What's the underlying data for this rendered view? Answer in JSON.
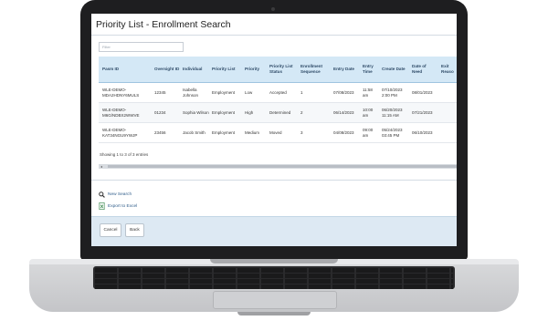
{
  "page": {
    "title": "Priority List - Enrollment Search",
    "filter_placeholder": "Filter"
  },
  "table": {
    "columns": [
      "Pasm ID",
      "Oversight ID",
      "Individual",
      "Priority List",
      "Priority",
      "Priority List Status",
      "Enrollment Sequence",
      "Entry Date",
      "Entry Time",
      "Create Date",
      "Date of Need",
      "Exit Reaso"
    ],
    "rows": [
      [
        "WLE-DEMO-MDA2HDNY6MULS",
        "12345",
        "Isabella Johnson",
        "Employment",
        "Low",
        "Accepted",
        "1",
        "07/08/2023",
        "11:58 am",
        "07/10/2023 2:00 PM",
        "08/01/2023",
        ""
      ],
      [
        "WLE-DEMO-M6G/NDBX2WWVE",
        "01234",
        "Sophia Wilson",
        "Employment",
        "High",
        "Determined",
        "2",
        "06/14/2023",
        "10:00 am",
        "06/20/2023 11:15 AM",
        "07/21/2023",
        ""
      ],
      [
        "WLE-DEMO-KAT34NGU9YWJP",
        "23456",
        "Jacob Smith",
        "Employment",
        "Medium",
        "Moved",
        "3",
        "04/08/2023",
        "09:00 am",
        "05/24/2023 03:45 PM",
        "06/10/2023",
        ""
      ]
    ],
    "showing_text": "Showing 1 to 3 of 3 entries"
  },
  "actions": {
    "new_search": "New Search",
    "export": "Export to Excel",
    "new_search_icon": "search-icon",
    "export_icon": "excel-file-icon"
  },
  "footer": {
    "cancel": "Cancel",
    "back": "Back"
  }
}
